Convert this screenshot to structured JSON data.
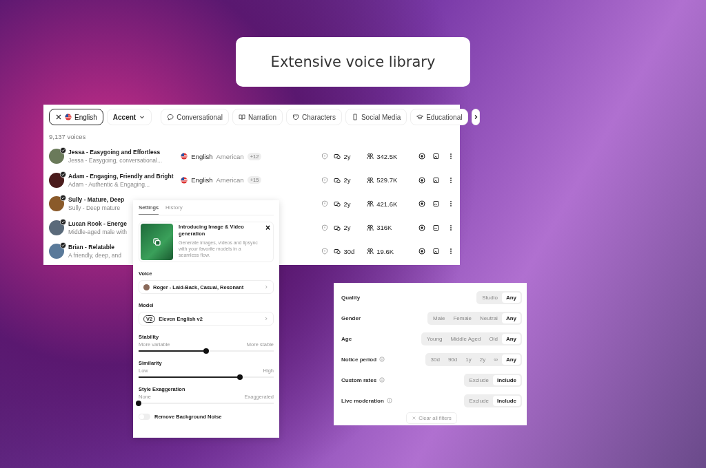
{
  "headline": "Extensive voice library",
  "voice_list": {
    "filters": [
      {
        "label": "English",
        "kind": "language",
        "selected": true
      },
      {
        "label": "Accent",
        "kind": "dropdown",
        "selected": false
      },
      {
        "label": "Conversational",
        "kind": "chat",
        "selected": false
      },
      {
        "label": "Narration",
        "kind": "book",
        "selected": false
      },
      {
        "label": "Characters",
        "kind": "mask",
        "selected": false
      },
      {
        "label": "Social Media",
        "kind": "phone",
        "selected": false
      },
      {
        "label": "Educational",
        "kind": "cap",
        "selected": false
      }
    ],
    "count": "9,137 voices",
    "rows": [
      {
        "name": "Jessa - Easygoing and Effortless",
        "description": "Jessa - Easygoing, conversational...",
        "language": "English",
        "accent": "American",
        "more": "+12",
        "notice": "2y",
        "users": "342.5K"
      },
      {
        "name": "Adam - Engaging, Friendly and Bright",
        "description": "Adam - Authentic & Engaging...",
        "language": "English",
        "accent": "American",
        "more": "+15",
        "notice": "2y",
        "users": "529.7K"
      },
      {
        "name": "Sully - Mature, Deep",
        "description": "Sully - Deep mature",
        "notice": "2y",
        "users": "421.6K"
      },
      {
        "name": "Lucan Rook - Energe",
        "description": "Middle-aged male with",
        "notice": "2y",
        "users": "316K"
      },
      {
        "name": "Brian - Relatable",
        "description": "A friendly, deep, and",
        "notice": "30d",
        "users": "19.6K"
      }
    ]
  },
  "settings": {
    "tabs": [
      {
        "label": "Settings",
        "selected": true
      },
      {
        "label": "History",
        "selected": false
      }
    ],
    "promo": {
      "title": "Introducing Image & Video generation",
      "text": "Generate images, videos and lipsync with your favorite models in a seamless flow.",
      "close": "×"
    },
    "voice_label": "Voice",
    "voice": "Roger - Laid-Back, Casual, Resonant",
    "model_label": "Model",
    "model_badge": "V2",
    "model": "Eleven English v2",
    "sliders": [
      {
        "label": "Stability",
        "low": "More variable",
        "high": "More stable",
        "level": 0.5
      },
      {
        "label": "Similarity",
        "low": "Low",
        "high": "High",
        "level": 0.75
      },
      {
        "label": "Style Exaggeration",
        "low": "None",
        "high": "Exaggerated",
        "level": 0.0
      }
    ],
    "toggle": {
      "label": "Remove Background Noise",
      "on": false
    }
  },
  "filters_panel": {
    "groups": [
      {
        "label": "Quality",
        "info": false,
        "options": [
          {
            "label": "Studio",
            "selected": false
          },
          {
            "label": "Any",
            "selected": true
          }
        ]
      },
      {
        "label": "Gender",
        "info": false,
        "options": [
          {
            "label": "Male",
            "selected": false
          },
          {
            "label": "Female",
            "selected": false
          },
          {
            "label": "Neutral",
            "selected": false
          },
          {
            "label": "Any",
            "selected": true
          }
        ]
      },
      {
        "label": "Age",
        "info": false,
        "options": [
          {
            "label": "Young",
            "selected": false
          },
          {
            "label": "Middle Aged",
            "selected": false
          },
          {
            "label": "Old",
            "selected": false
          },
          {
            "label": "Any",
            "selected": true
          }
        ]
      },
      {
        "label": "Notice period",
        "info": true,
        "options": [
          {
            "label": "30d",
            "selected": false
          },
          {
            "label": "90d",
            "selected": false
          },
          {
            "label": "1y",
            "selected": false
          },
          {
            "label": "2y",
            "selected": false
          },
          {
            "label": "∞",
            "selected": false
          },
          {
            "label": "Any",
            "selected": true
          }
        ]
      },
      {
        "label": "Custom rates",
        "info": true,
        "options": [
          {
            "label": "Exclude",
            "selected": false
          },
          {
            "label": "Include",
            "selected": true
          }
        ]
      },
      {
        "label": "Live moderation",
        "info": true,
        "options": [
          {
            "label": "Exclude",
            "selected": false
          },
          {
            "label": "Include",
            "selected": true
          }
        ]
      }
    ],
    "clear": "Clear all filters"
  }
}
